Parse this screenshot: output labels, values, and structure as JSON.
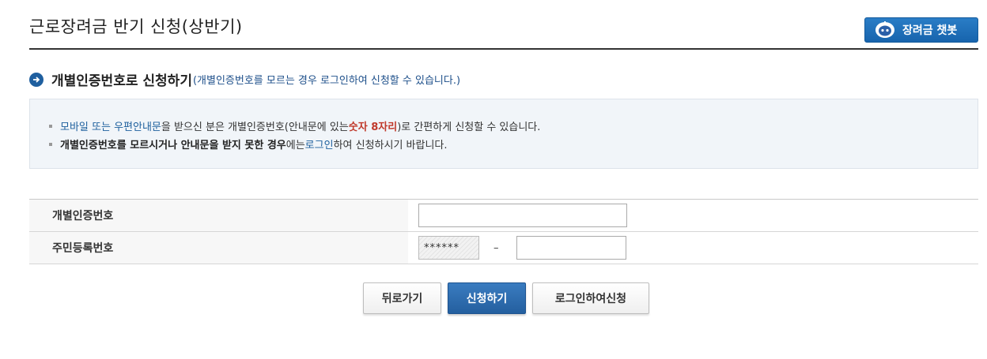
{
  "header": {
    "title": "근로장려금 반기 신청(상반기)",
    "chatbot_label": "장려금 챗봇"
  },
  "section": {
    "title": "개별인증번호로 신청하기",
    "subtitle": "(개별인증번호를 모르는 경우 로그인하여 신청할 수 있습니다.)"
  },
  "info": {
    "line1": {
      "link": "모바일 또는 우편안내문",
      "text1": "을 받으신 분은 개별인증번호(안내문에 있는 ",
      "highlight": "숫자 8자리",
      "text2": ")로 간편하게 신청할 수 있습니다."
    },
    "line2": {
      "bold": "개별인증번호를 모르시거나 안내문을 받지 못한 경우",
      "text1": "에는 ",
      "link": "로그인",
      "text2": "하여 신청하시기 바랍니다."
    }
  },
  "form": {
    "auth_label": "개별인증번호",
    "auth_value": "",
    "rrn_label": "주민등록번호",
    "rrn_front_mask": "******",
    "rrn_dash": "–",
    "rrn_back_value": ""
  },
  "buttons": {
    "back": "뒤로가기",
    "apply": "신청하기",
    "login_apply": "로그인하여신청"
  },
  "colors": {
    "primary": "#1f5f9f",
    "highlight": "#c0392b",
    "link": "#1d5f9d"
  }
}
